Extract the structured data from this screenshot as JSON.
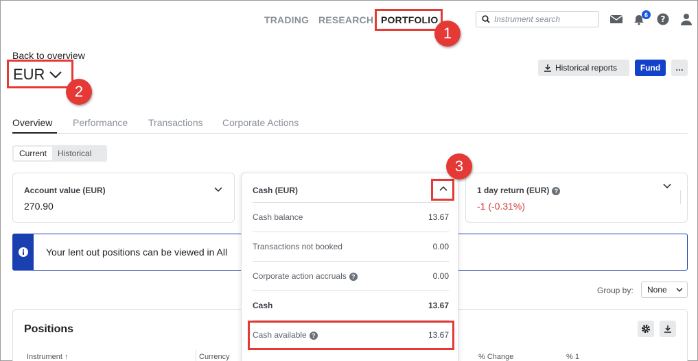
{
  "nav": {
    "trading": "TRADING",
    "research": "RESEARCH",
    "portfolio": "PORTFOLIO"
  },
  "search": {
    "placeholder": "Instrument search"
  },
  "notifications": {
    "count": "6"
  },
  "header": {
    "back_link": "Back to overview",
    "currency": "EUR",
    "historical_reports": "Historical reports",
    "fund": "Fund",
    "more": "…"
  },
  "tabs": [
    "Overview",
    "Performance",
    "Transactions",
    "Corporate Actions"
  ],
  "segment": {
    "current": "Current",
    "historical": "Historical"
  },
  "cards": {
    "account_value": {
      "label": "Account value (EUR)",
      "value": "270.90"
    },
    "cash": {
      "label": "Cash (EUR)"
    },
    "day_return": {
      "label": "1 day return (EUR)",
      "value": "-1 (-0.31%)"
    }
  },
  "info": {
    "text": "Your lent out positions can be viewed in All"
  },
  "cash_breakdown": [
    {
      "label": "Cash balance",
      "value": "13.67"
    },
    {
      "label": "Transactions not booked",
      "value": "0.00"
    },
    {
      "label": "Corporate action accruals",
      "value": "0.00"
    },
    {
      "label": "Cash",
      "value": "13.67"
    },
    {
      "label": "Cash available",
      "value": "13.67"
    }
  ],
  "group_by": {
    "label": "Group by:",
    "value": "None"
  },
  "positions": {
    "title": "Positions",
    "columns": [
      "Instrument ↑",
      "Currency",
      "% Change",
      "% 1"
    ]
  },
  "markers": [
    "1",
    "2",
    "3"
  ],
  "colors": {
    "accent": "#1341c9",
    "highlight": "#e53935",
    "negative": "#d23a3a"
  }
}
